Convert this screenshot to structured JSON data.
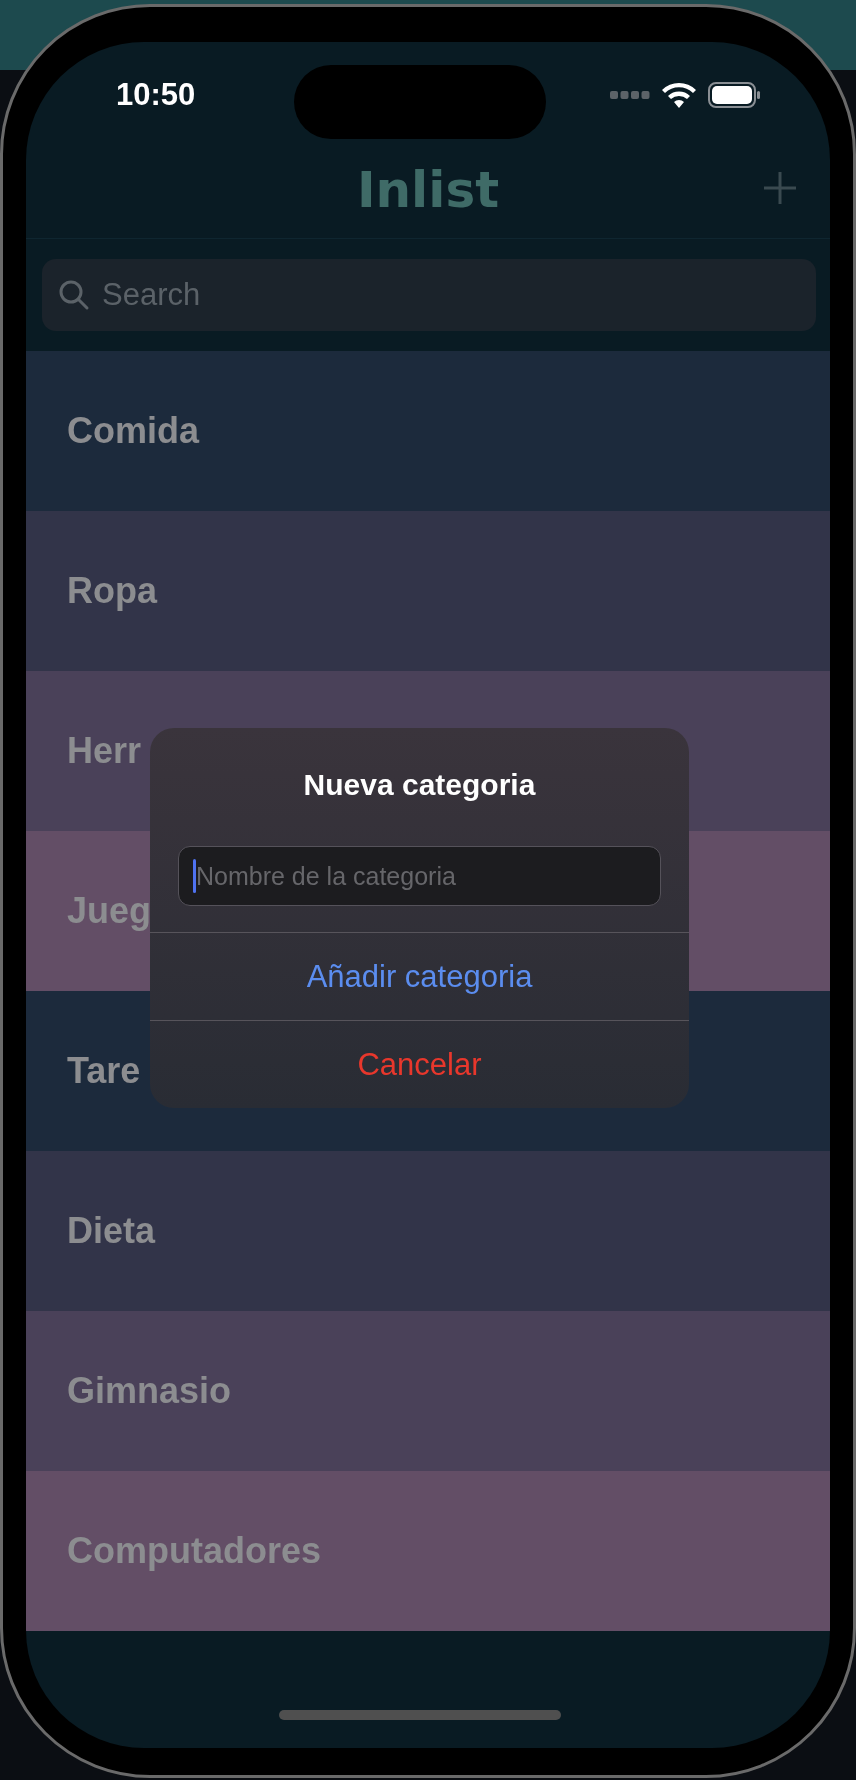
{
  "status_bar": {
    "time": "10:50"
  },
  "nav": {
    "title": "Inlist"
  },
  "search": {
    "placeholder": "Search"
  },
  "categories": [
    {
      "name": "Comida",
      "color": "#1c2a3c"
    },
    {
      "name": "Ropa",
      "color": "#323449"
    },
    {
      "name": "Herr",
      "color": "#4a4159"
    },
    {
      "name": "Jueg",
      "color": "#634e66"
    },
    {
      "name": "Tare",
      "color": "#1c2a3c"
    },
    {
      "name": "Dieta",
      "color": "#323449"
    },
    {
      "name": "Gimnasio",
      "color": "#4a4159"
    },
    {
      "name": "Computadores",
      "color": "#634e66"
    }
  ],
  "dialog": {
    "title": "Nueva categoria",
    "field": {
      "placeholder": "Nombre de la categoria",
      "focused": true
    },
    "actions": [
      {
        "label": "Añadir categoria",
        "kind": "default"
      },
      {
        "label": "Cancelar",
        "kind": "destructive"
      }
    ]
  }
}
